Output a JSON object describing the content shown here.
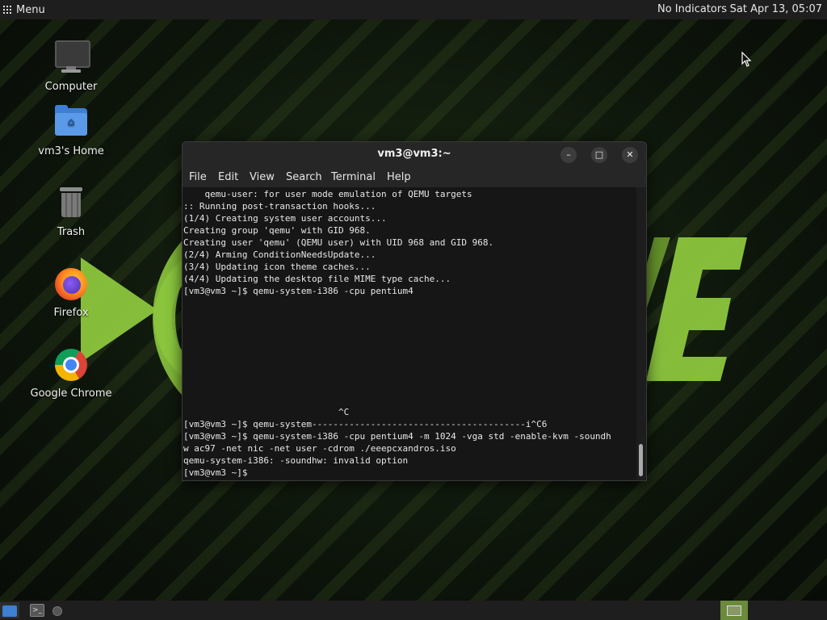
{
  "top_panel": {
    "menu_label": "Menu",
    "indicators": "No Indicators",
    "clock": "Sat Apr 13, 05:07"
  },
  "desktop": {
    "icons": [
      {
        "label": "Computer",
        "icon": "computer-icon"
      },
      {
        "label": "vm3's Home",
        "icon": "home-folder-icon"
      },
      {
        "label": "Trash",
        "icon": "trash-icon"
      },
      {
        "label": "Firefox",
        "icon": "firefox-icon"
      },
      {
        "label": "Google Chrome",
        "icon": "chrome-icon"
      }
    ],
    "wallpaper_accent": "#8cc63e"
  },
  "terminal": {
    "title": "vm3@vm3:~",
    "menu": [
      "File",
      "Edit",
      "View",
      "Search",
      "Terminal",
      "Help"
    ],
    "lines": [
      "    qemu-user: for user mode emulation of QEMU targets",
      ":: Running post-transaction hooks...",
      "(1/4) Creating system user accounts...",
      "Creating group 'qemu' with GID 968.",
      "Creating user 'qemu' (QEMU user) with UID 968 and GID 968.",
      "(2/4) Arming ConditionNeedsUpdate...",
      "(3/4) Updating icon theme caches...",
      "(4/4) Updating the desktop file MIME type cache...",
      "[vm3@vm3 ~]$ qemu-system-i386 -cpu pentium4",
      "",
      "",
      "",
      "",
      "",
      "",
      "                             ^C",
      "[vm3@vm3 ~]$ qemu-system----------------------------------------i^C6",
      "[vm3@vm3 ~]$ qemu-system-i386 -cpu pentium4 -m 1024 -vga std -enable-kvm -soundh",
      "w ac97 -net nic -net user -cdrom ./eeepcxandros.iso",
      "qemu-system-i386: -soundhw: invalid option",
      "[vm3@vm3 ~]$"
    ]
  },
  "colors": {
    "panel_bg": "#1e1e1e",
    "terminal_bg": "#161616",
    "terminal_fg": "#e8e8e8",
    "mint_green": "#8cc63e"
  }
}
